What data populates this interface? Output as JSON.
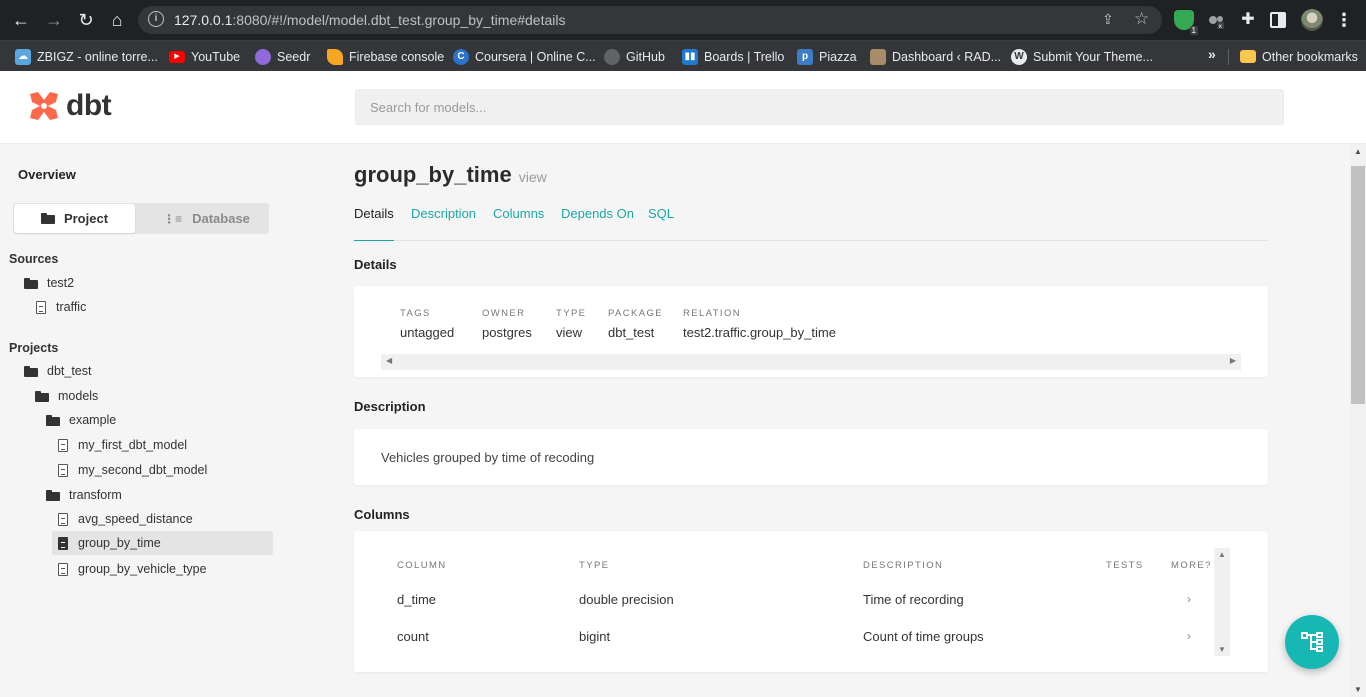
{
  "browser": {
    "url_host": "127.0.0.1",
    "url_rest": ":8080/#!/model/model.dbt_test.group_by_time#details",
    "bookmarks": [
      {
        "label": "ZBIGZ - online torre...",
        "icon": "cloud-icon",
        "color": "#5aa7e0"
      },
      {
        "label": "YouTube",
        "icon": "youtube-icon",
        "color": "#ff0000"
      },
      {
        "label": "Seedr",
        "icon": "seedr-icon",
        "color": "#8e6bd9"
      },
      {
        "label": "Firebase console",
        "icon": "firebase-icon",
        "color": "#f6a623"
      },
      {
        "label": "Coursera | Online C...",
        "icon": "coursera-icon",
        "color": "#2a73cc"
      },
      {
        "label": "GitHub",
        "icon": "github-icon",
        "color": "#5f6368"
      },
      {
        "label": "Boards | Trello",
        "icon": "trello-icon",
        "color": "#1f7ad0"
      },
      {
        "label": "Piazza",
        "icon": "piazza-icon",
        "color": "#3e7dc6"
      },
      {
        "label": "Dashboard ‹ RAD...",
        "icon": "dashboard-icon",
        "color": "#a88c6a"
      },
      {
        "label": "Submit Your Theme...",
        "icon": "wordpress-icon",
        "color": "#e8eaed"
      }
    ],
    "more": "»",
    "other_bookmarks": "Other bookmarks",
    "shield_badge": "1"
  },
  "app": {
    "logo_text": "dbt",
    "brand_color": "#ff694b",
    "accent_color": "#1aa8a6",
    "search_placeholder": "Search for models..."
  },
  "sidebar": {
    "overview": "Overview",
    "project_label": "Project",
    "database_label": "Database",
    "sources_heading": "Sources",
    "projects_heading": "Projects",
    "sources": {
      "folder": "test2",
      "files": [
        "traffic"
      ]
    },
    "project_tree": {
      "root": "dbt_test",
      "models": "models",
      "example": "example",
      "example_files": [
        "my_first_dbt_model",
        "my_second_dbt_model"
      ],
      "transform": "transform",
      "transform_files": [
        "avg_speed_distance",
        "group_by_time",
        "group_by_vehicle_type"
      ]
    }
  },
  "model": {
    "name": "group_by_time",
    "materialization": "view",
    "tabs": [
      "Details",
      "Description",
      "Columns",
      "Depends On",
      "SQL"
    ],
    "details_heading": "Details",
    "details": [
      {
        "label": "TAGS",
        "value": "untagged"
      },
      {
        "label": "OWNER",
        "value": "postgres"
      },
      {
        "label": "TYPE",
        "value": "view"
      },
      {
        "label": "PACKAGE",
        "value": "dbt_test"
      },
      {
        "label": "RELATION",
        "value": "test2.traffic.group_by_time"
      }
    ],
    "description_heading": "Description",
    "description": "Vehicles grouped by time of recoding",
    "columns_heading": "Columns",
    "column_headers": [
      "COLUMN",
      "TYPE",
      "DESCRIPTION",
      "TESTS",
      "MORE?"
    ],
    "columns": [
      {
        "name": "d_time",
        "type": "double precision",
        "description": "Time of recording"
      },
      {
        "name": "count",
        "type": "bigint",
        "description": "Count of time groups"
      }
    ]
  }
}
